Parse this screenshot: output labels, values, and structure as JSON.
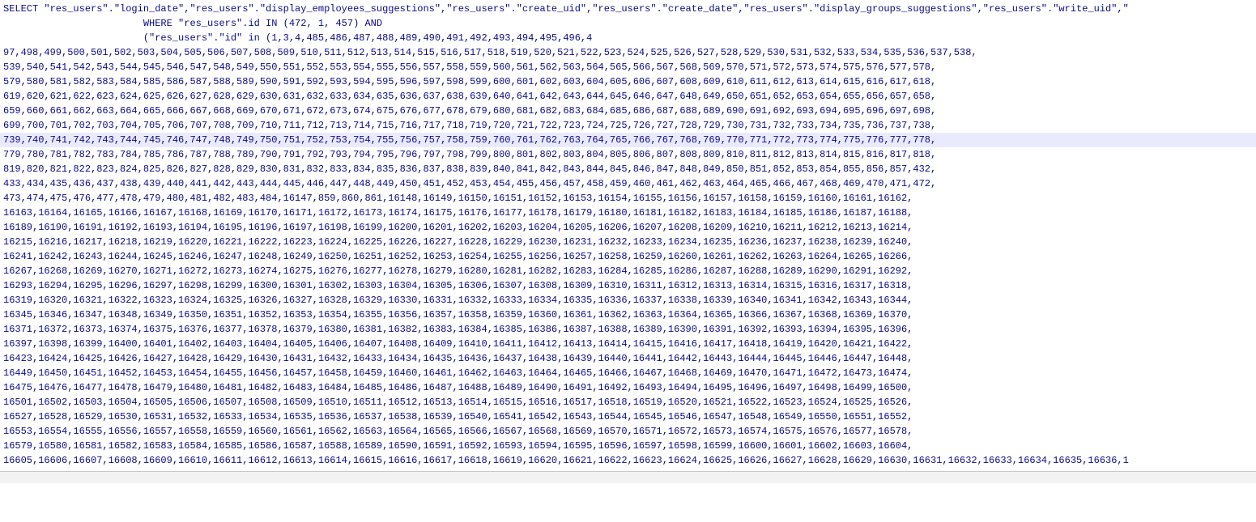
{
  "sql": {
    "line1": "SELECT \"res_users\".\"login_date\",\"res_users\".\"display_employees_suggestions\",\"res_users\".\"create_uid\",\"res_users\".\"create_date\",\"res_users\".\"display_groups_suggestions\",\"res_users\".\"write_uid\",\"",
    "line2": "                        WHERE \"res_users\".id IN (472, 1, 457) AND",
    "line3": "                        (\"res_users\".\"id\" in (1,3,4,485,486,487,488,489,490,491,492,493,494,495,496,4",
    "line4": "97,498,499,500,501,502,503,504,505,506,507,508,509,510,511,512,513,514,515,516,517,518,519,520,521,522,523,524,525,526,527,528,529,530,531,532,533,534,535,536,537,538,",
    "line5": "539,540,541,542,543,544,545,546,547,548,549,550,551,552,553,554,555,556,557,558,559,560,561,562,563,564,565,566,567,568,569,570,571,572,573,574,575,576,577,578,",
    "line6": "579,580,581,582,583,584,585,586,587,588,589,590,591,592,593,594,595,596,597,598,599,600,601,602,603,604,605,606,607,608,609,610,611,612,613,614,615,616,617,618,",
    "line7": "619,620,621,622,623,624,625,626,627,628,629,630,631,632,633,634,635,636,637,638,639,640,641,642,643,644,645,646,647,648,649,650,651,652,653,654,655,656,657,658,",
    "line8": "659,660,661,662,663,664,665,666,667,668,669,670,671,672,673,674,675,676,677,678,679,680,681,682,683,684,685,686,687,688,689,690,691,692,693,694,695,696,697,698,",
    "line9": "699,700,701,702,703,704,705,706,707,708,709,710,711,712,713,714,715,716,717,718,719,720,721,722,723,724,725,726,727,728,729,730,731,732,733,734,735,736,737,738,",
    "line10": "739,740,741,742,743,744,745,746,747,748,749,750,751,752,753,754,755,756,757,758,759,760,761,762,763,764,765,766,767,768,769,770,771,772,773,774,775,776,777,778,",
    "line11": "779,780,781,782,783,784,785,786,787,788,789,790,791,792,793,794,795,796,797,798,799,800,801,802,803,804,805,806,807,808,809,810,811,812,813,814,815,816,817,818,",
    "line12": "819,820,821,822,823,824,825,826,827,828,829,830,831,832,833,834,835,836,837,838,839,840,841,842,843,844,845,846,847,848,849,850,851,852,853,854,855,856,857,432,",
    "line13": "433,434,435,436,437,438,439,440,441,442,443,444,445,446,447,448,449,450,451,452,453,454,455,456,457,458,459,460,461,462,463,464,465,466,467,468,469,470,471,472,",
    "line14": "473,474,475,476,477,478,479,480,481,482,483,484,16147,859,860,861,16148,16149,16150,16151,16152,16153,16154,16155,16156,16157,16158,16159,16160,16161,16162,",
    "line15": "16163,16164,16165,16166,16167,16168,16169,16170,16171,16172,16173,16174,16175,16176,16177,16178,16179,16180,16181,16182,16183,16184,16185,16186,16187,16188,",
    "line16": "16189,16190,16191,16192,16193,16194,16195,16196,16197,16198,16199,16200,16201,16202,16203,16204,16205,16206,16207,16208,16209,16210,16211,16212,16213,16214,",
    "line17": "16215,16216,16217,16218,16219,16220,16221,16222,16223,16224,16225,16226,16227,16228,16229,16230,16231,16232,16233,16234,16235,16236,16237,16238,16239,16240,",
    "line18": "16241,16242,16243,16244,16245,16246,16247,16248,16249,16250,16251,16252,16253,16254,16255,16256,16257,16258,16259,16260,16261,16262,16263,16264,16265,16266,",
    "line19": "16267,16268,16269,16270,16271,16272,16273,16274,16275,16276,16277,16278,16279,16280,16281,16282,16283,16284,16285,16286,16287,16288,16289,16290,16291,16292,",
    "line20": "16293,16294,16295,16296,16297,16298,16299,16300,16301,16302,16303,16304,16305,16306,16307,16308,16309,16310,16311,16312,16313,16314,16315,16316,16317,16318,",
    "line21": "16319,16320,16321,16322,16323,16324,16325,16326,16327,16328,16329,16330,16331,16332,16333,16334,16335,16336,16337,16338,16339,16340,16341,16342,16343,16344,",
    "line22": "16345,16346,16347,16348,16349,16350,16351,16352,16353,16354,16355,16356,16357,16358,16359,16360,16361,16362,16363,16364,16365,16366,16367,16368,16369,16370,",
    "line23": "16371,16372,16373,16374,16375,16376,16377,16378,16379,16380,16381,16382,16383,16384,16385,16386,16387,16388,16389,16390,16391,16392,16393,16394,16395,16396,",
    "line24": "16397,16398,16399,16400,16401,16402,16403,16404,16405,16406,16407,16408,16409,16410,16411,16412,16413,16414,16415,16416,16417,16418,16419,16420,16421,16422,",
    "line25": "16423,16424,16425,16426,16427,16428,16429,16430,16431,16432,16433,16434,16435,16436,16437,16438,16439,16440,16441,16442,16443,16444,16445,16446,16447,16448,",
    "line26": "16449,16450,16451,16452,16453,16454,16455,16456,16457,16458,16459,16460,16461,16462,16463,16464,16465,16466,16467,16468,16469,16470,16471,16472,16473,16474,",
    "line27": "16475,16476,16477,16478,16479,16480,16481,16482,16483,16484,16485,16486,16487,16488,16489,16490,16491,16492,16493,16494,16495,16496,16497,16498,16499,16500,",
    "line28": "16501,16502,16503,16504,16505,16506,16507,16508,16509,16510,16511,16512,16513,16514,16515,16516,16517,16518,16519,16520,16521,16522,16523,16524,16525,16526,",
    "line29": "16527,16528,16529,16530,16531,16532,16533,16534,16535,16536,16537,16538,16539,16540,16541,16542,16543,16544,16545,16546,16547,16548,16549,16550,16551,16552,",
    "line30": "16553,16554,16555,16556,16557,16558,16559,16560,16561,16562,16563,16564,16565,16566,16567,16568,16569,16570,16571,16572,16573,16574,16575,16576,16577,16578,",
    "line31": "16579,16580,16581,16582,16583,16584,16585,16586,16587,16588,16589,16590,16591,16592,16593,16594,16595,16596,16597,16598,16599,16600,16601,16602,16603,16604,",
    "line32": "16605,16606,16607,16608,16609,16610,16611,16612,16613,16614,16615,16616,16617,16618,16619,16620,16621,16622,16623,16624,16625,16626,16627,16628,16629,16630,16631,16632,16633,16634,16635,16636,1"
  },
  "highlighted_line": 10
}
